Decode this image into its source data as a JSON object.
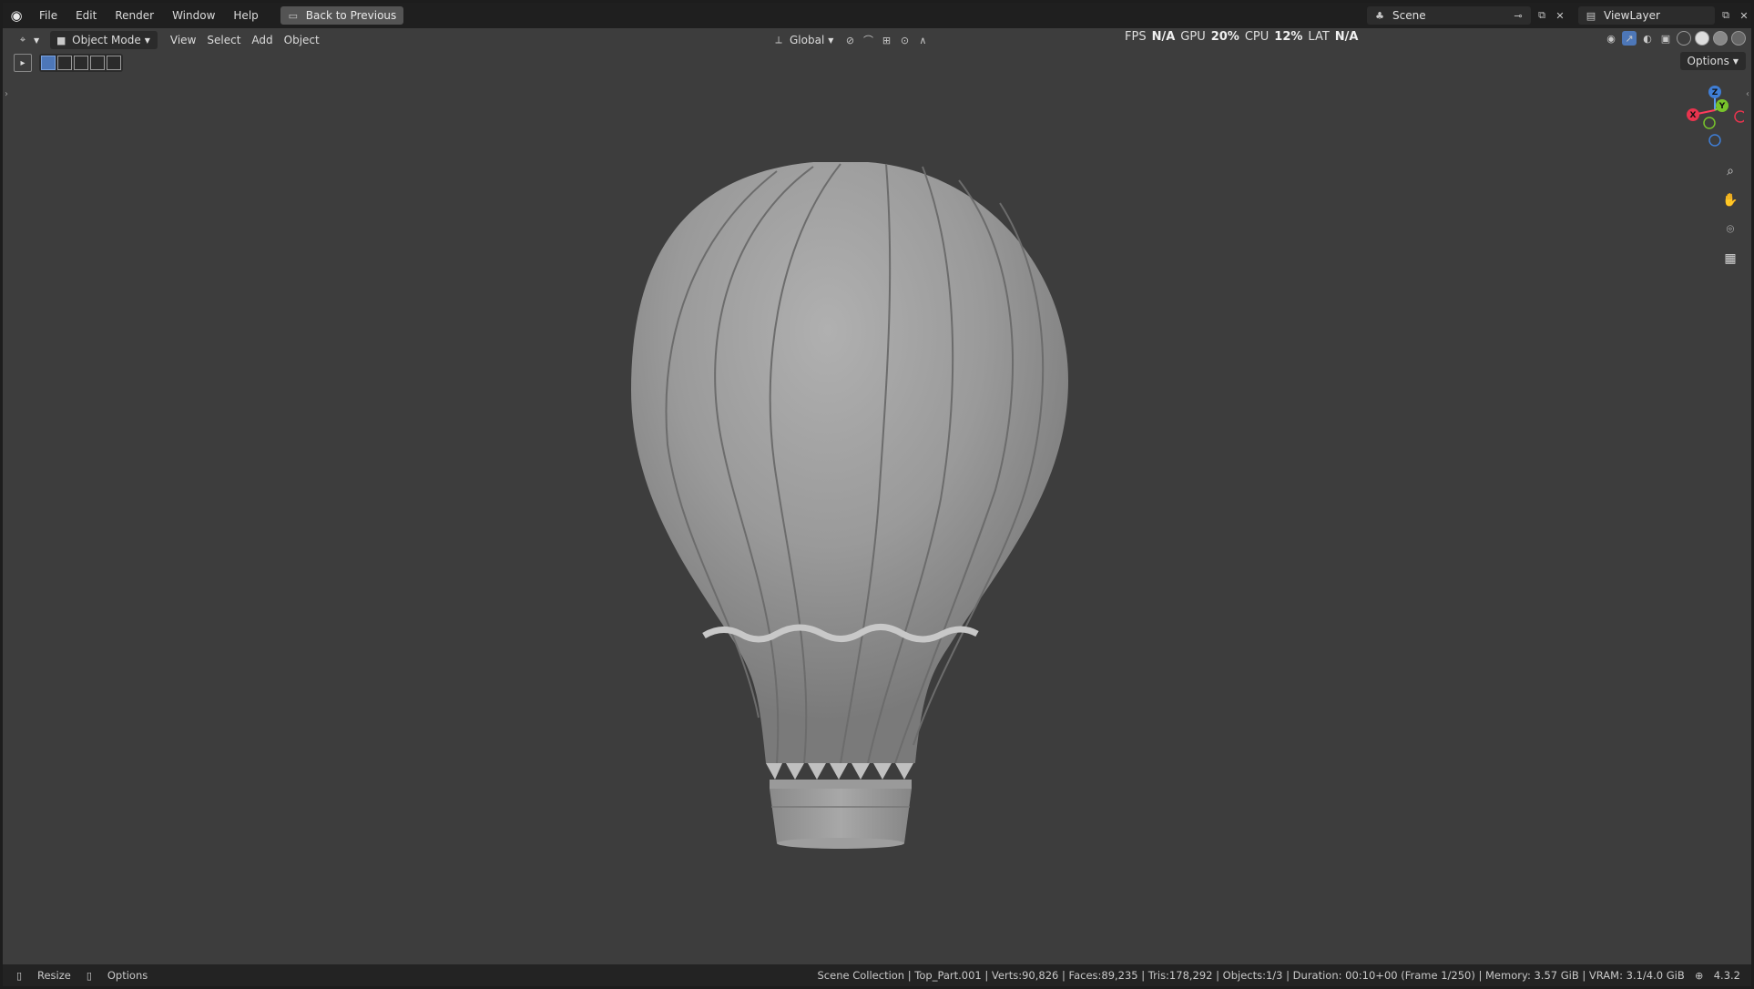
{
  "menu": [
    "File",
    "Edit",
    "Render",
    "Window",
    "Help"
  ],
  "back_button": "Back to Previous",
  "scene": "Scene",
  "view_layer": "ViewLayer",
  "header": {
    "mode": "Object Mode",
    "menus": [
      "View",
      "Select",
      "Add",
      "Object"
    ],
    "transform_orientation": "Global"
  },
  "stats": {
    "fps_label": "FPS",
    "fps_value": "N/A",
    "gpu_label": "GPU",
    "gpu_value": "20%",
    "cpu_label": "CPU",
    "cpu_value": "12%",
    "lat_label": "LAT",
    "lat_value": "N/A"
  },
  "options_label": "Options",
  "gizmo": {
    "z": "Z",
    "y": "Y",
    "x": "X"
  },
  "status": {
    "left": [
      "Resize",
      "Options"
    ],
    "right": "Scene Collection | Top_Part.001 | Verts:90,826 | Faces:89,235 | Tris:178,292 | Objects:1/3 | Duration: 00:10+00 (Frame 1/250) | Memory: 3.57 GiB | VRAM: 3.1/4.0 GiB",
    "version": "4.3.2"
  },
  "colors": {
    "viewport_bg": "#3d3d3d",
    "header_bg": "#1f1f1f",
    "accent": "#4d77b8"
  }
}
